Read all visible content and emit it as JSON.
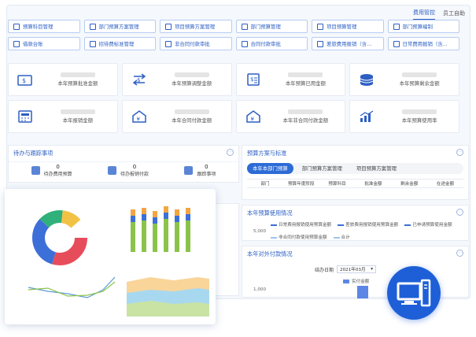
{
  "topbar": {
    "tabs": [
      {
        "label": "费用管控",
        "active": true
      },
      {
        "label": "员工自助",
        "active": false
      }
    ]
  },
  "quick_links": [
    {
      "label": "预算科目管理",
      "icon": "budget-subject-icon"
    },
    {
      "label": "部门预算方案管理",
      "icon": "dept-plan-icon"
    },
    {
      "label": "项目预算方案管理",
      "icon": "project-plan-icon"
    },
    {
      "label": "部门预算管理",
      "icon": "dept-budget-icon"
    },
    {
      "label": "项目预算管理",
      "icon": "project-budget-icon"
    },
    {
      "label": "部门预算编制",
      "icon": "dept-compile-icon"
    },
    {
      "label": "借款台账",
      "icon": "loan-ledger-icon"
    },
    {
      "label": "招待费标准管理",
      "icon": "entertain-icon"
    },
    {
      "label": "非合同付款审批",
      "icon": "noncontract-icon"
    },
    {
      "label": "合同付款审批",
      "icon": "contract-icon"
    },
    {
      "label": "差旅费用报销（含...",
      "icon": "travel-icon"
    },
    {
      "label": "日常费用报销（含...",
      "icon": "daily-icon"
    }
  ],
  "stats": [
    {
      "label": "本年预算批准金额",
      "icon": "wallet-icon"
    },
    {
      "label": "本年预算调整金额",
      "icon": "exchange-icon"
    },
    {
      "label": "本年预算已用金额",
      "icon": "document-money-icon"
    },
    {
      "label": "本年预算剩余金额",
      "icon": "coins-icon"
    },
    {
      "label": "本年报销金额",
      "icon": "calculator-icon"
    },
    {
      "label": "本年合同付款金额",
      "icon": "yen-house-icon"
    },
    {
      "label": "本年非合同付款金额",
      "icon": "yen-house-icon"
    },
    {
      "label": "本年预算使用率",
      "icon": "bar-trend-icon"
    }
  ],
  "todo_panel": {
    "title": "待办与跟踪事项",
    "items": [
      {
        "count": "0",
        "label": "待办费用预算"
      },
      {
        "count": "0",
        "label": "待办报销付款"
      },
      {
        "count": "0",
        "label": "跟踪事项"
      }
    ]
  },
  "plan_panel": {
    "title": "预算方案与标准",
    "tabs": [
      {
        "label": "本年本部门预算",
        "active": true
      },
      {
        "label": "部门预算方案管理",
        "active": false
      },
      {
        "label": "项目预算方案管理",
        "active": false
      }
    ],
    "columns": [
      "部门",
      "预算年度阶段",
      "预算科目",
      "批准金额",
      "剩余金额",
      "在途金额"
    ]
  },
  "usage_panel": {
    "title": "本年预算使用情况",
    "y_tick": "5,000",
    "legend": [
      "日常费用报销使用预算金额",
      "差旅费用报销使用预算金额",
      "已申请预算使用金额",
      "非合同付款使用预算金额",
      "合计"
    ]
  },
  "payment_panel": {
    "title": "本年对外付款情况",
    "date_label": "结办日期",
    "date_value": "2021年03月",
    "legend": "实付金额",
    "y_tick": "1,000"
  },
  "colors": {
    "accent": "#2d5fc4",
    "primary_tab": "#2d6bd6",
    "pc_circle": "#1e5fd8"
  }
}
